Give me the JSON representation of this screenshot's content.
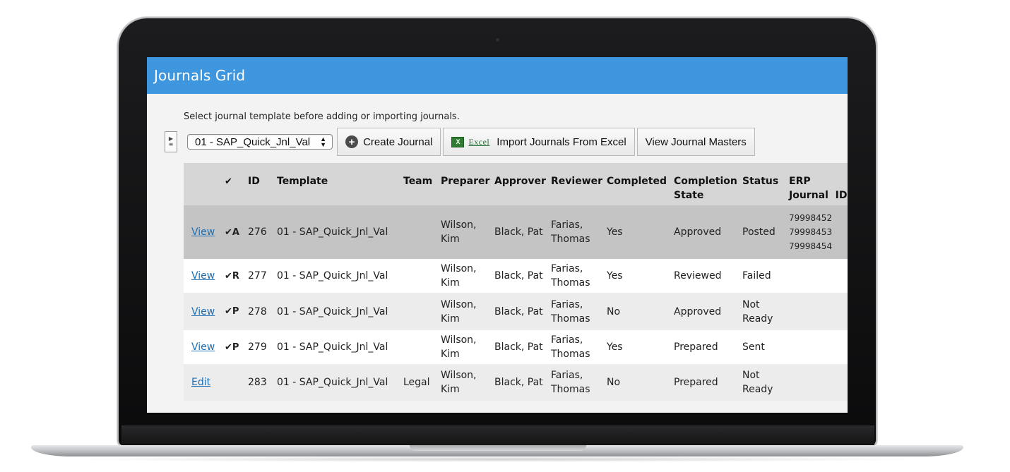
{
  "window": {
    "title": "Journals Grid"
  },
  "toolbar": {
    "hint": "Select journal template before adding or importing journals.",
    "template_value": "01 - SAP_Quick_Jnl_Val",
    "create_label": "Create Journal",
    "excel_word": "Excel",
    "import_label": "Import Journals From Excel",
    "masters_label": "View Journal Masters"
  },
  "grid": {
    "headers": {
      "check": "✔",
      "id": "ID",
      "template": "Template",
      "team": "Team",
      "preparer": "Preparer",
      "approver": "Approver",
      "reviewer": "Reviewer",
      "completed": "Completed",
      "completion_state_1": "Completion",
      "completion_state_2": "State",
      "status": "Status",
      "erp_1": "ERP",
      "erp_2": "Journal  ID"
    },
    "rows": [
      {
        "action": "View",
        "check": "✔A",
        "id": "276",
        "template": "01 - SAP_Quick_Jnl_Val",
        "team": "",
        "preparer_1": "Wilson,",
        "preparer_2": "Kim",
        "approver": "Black, Pat",
        "reviewer_1": "Farias,",
        "reviewer_2": "Thomas",
        "completed": "Yes",
        "state": "Approved",
        "status_1": "Posted",
        "status_2": "",
        "erp": [
          "79998452",
          "79998453",
          "79998454"
        ]
      },
      {
        "action": "View",
        "check": "✔R",
        "id": "277",
        "template": "01 - SAP_Quick_Jnl_Val",
        "team": "",
        "preparer_1": "Wilson,",
        "preparer_2": "Kim",
        "approver": "Black, Pat",
        "reviewer_1": "Farias,",
        "reviewer_2": "Thomas",
        "completed": "Yes",
        "state": "Reviewed",
        "status_1": "Failed",
        "status_2": "",
        "erp": [
          "",
          "",
          ""
        ]
      },
      {
        "action": "View",
        "check": "✔P",
        "id": "278",
        "template": "01 - SAP_Quick_Jnl_Val",
        "team": "",
        "preparer_1": "Wilson,",
        "preparer_2": "Kim",
        "approver": "Black, Pat",
        "reviewer_1": "Farias,",
        "reviewer_2": "Thomas",
        "completed": "No",
        "state": "Approved",
        "status_1": "Not",
        "status_2": "Ready",
        "erp": [
          "",
          "",
          ""
        ]
      },
      {
        "action": "View",
        "check": "✔P",
        "id": "279",
        "template": "01 - SAP_Quick_Jnl_Val",
        "team": "",
        "preparer_1": "Wilson,",
        "preparer_2": "Kim",
        "approver": "Black, Pat",
        "reviewer_1": "Farias,",
        "reviewer_2": "Thomas",
        "completed": "Yes",
        "state": "Prepared",
        "status_1": "Sent",
        "status_2": "",
        "erp": [
          "",
          "",
          ""
        ]
      },
      {
        "action": "Edit",
        "check": "",
        "id": "283",
        "template": "01 - SAP_Quick_Jnl_Val",
        "team": "Legal",
        "preparer_1": "Wilson,",
        "preparer_2": "Kim",
        "approver": "Black, Pat",
        "reviewer_1": "Farias,",
        "reviewer_2": "Thomas",
        "completed": "No",
        "state": "Prepared",
        "status_1": "Not",
        "status_2": "Ready",
        "erp": [
          "",
          "",
          ""
        ]
      }
    ]
  },
  "colors": {
    "titlebar": "#3d96de",
    "link": "#1f6fb2",
    "selected_row": "#c4c4c4"
  }
}
